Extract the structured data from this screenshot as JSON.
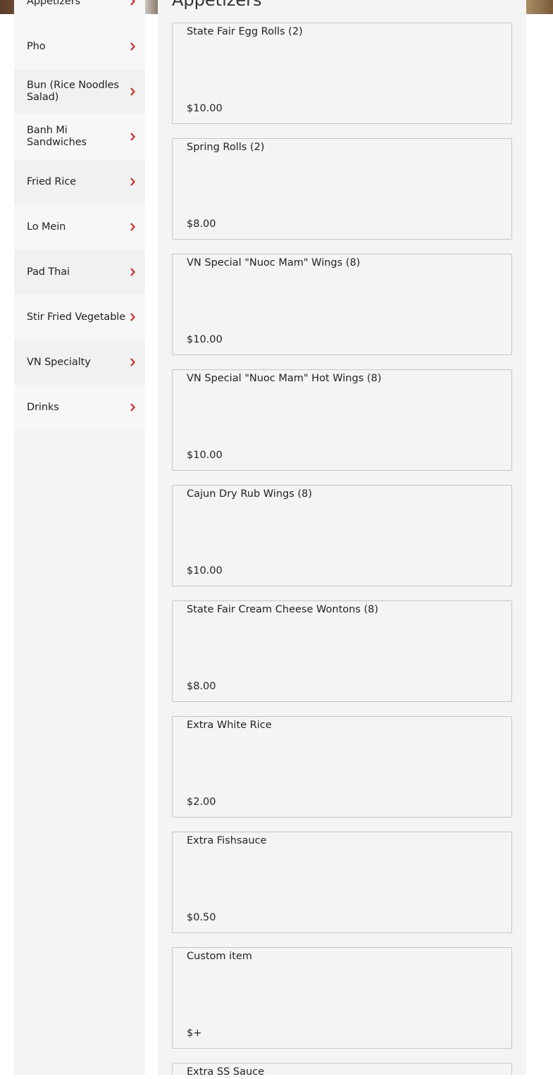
{
  "colors": {
    "accent": "#c8312b",
    "panel_bg": "#f4f4f4",
    "border": "#c6c6c6",
    "text": "#222222"
  },
  "sidebar": {
    "chevron_icon": "chevron-right-icon",
    "items": [
      {
        "label": "Appetizers"
      },
      {
        "label": "Pho"
      },
      {
        "label": "Bun (Rice Noodles Salad)"
      },
      {
        "label": "Banh Mi Sandwiches"
      },
      {
        "label": "Fried Rice"
      },
      {
        "label": "Lo Mein"
      },
      {
        "label": "Pad Thai"
      },
      {
        "label": "Stir Fried Vegetable"
      },
      {
        "label": "VN Specialty"
      },
      {
        "label": "Drinks"
      }
    ]
  },
  "main": {
    "section_title": "Appetizers",
    "items": [
      {
        "name": "State Fair Egg Rolls (2)",
        "price": "$10.00"
      },
      {
        "name": "Spring Rolls (2)",
        "price": "$8.00"
      },
      {
        "name": "VN Special \"Nuoc Mam\" Wings (8)",
        "price": "$10.00"
      },
      {
        "name": "VN Special \"Nuoc Mam\" Hot Wings (8)",
        "price": "$10.00"
      },
      {
        "name": "Cajun Dry Rub Wings (8)",
        "price": "$10.00"
      },
      {
        "name": "State Fair Cream Cheese Wontons (8)",
        "price": "$8.00"
      },
      {
        "name": "Extra White Rice",
        "price": "$2.00"
      },
      {
        "name": "Extra Fishsauce",
        "price": "$0.50"
      },
      {
        "name": "Custom item",
        "price": "$+"
      },
      {
        "name": "Extra SS Sauce",
        "price": ""
      }
    ]
  }
}
